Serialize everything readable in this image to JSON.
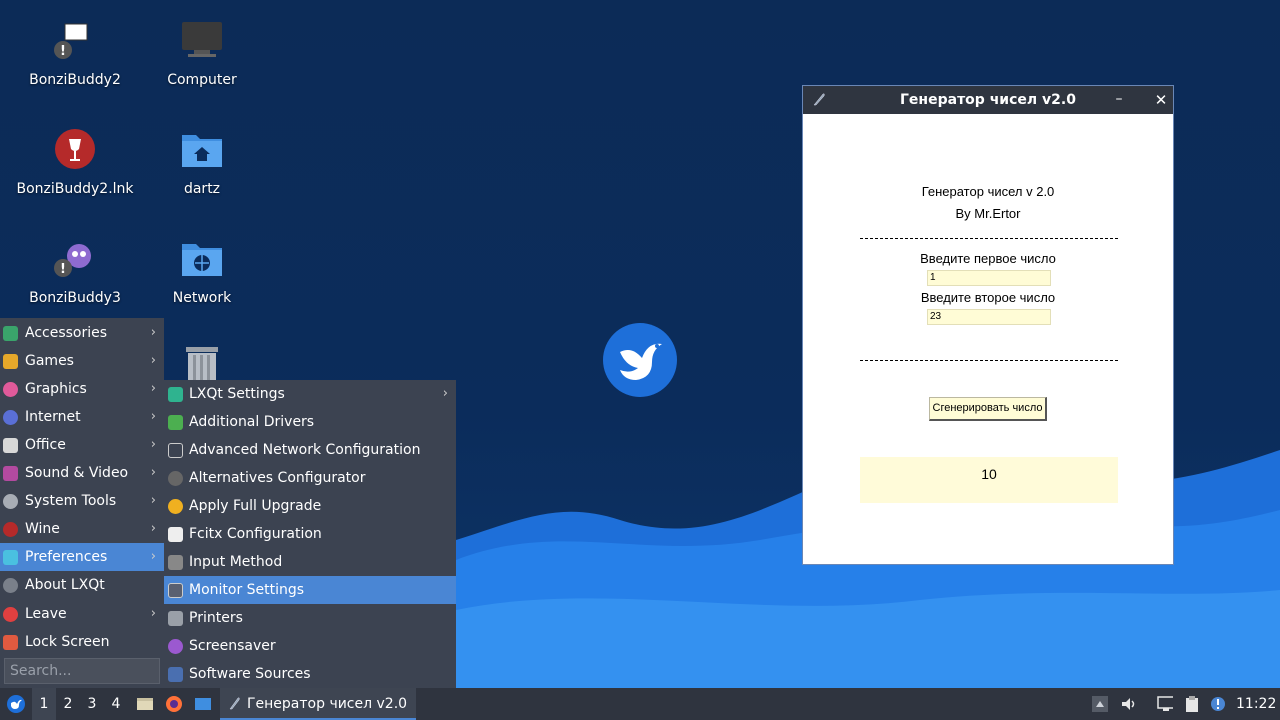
{
  "desktop": {
    "icons": [
      {
        "label": "BonziBuddy2"
      },
      {
        "label": "Computer"
      },
      {
        "label": "BonziBuddy2.lnk"
      },
      {
        "label": "dartz"
      },
      {
        "label": "BonziBuddy3"
      },
      {
        "label": "Network"
      }
    ]
  },
  "window": {
    "title": "Генератор чисел v2.0",
    "minimize_glyph": "–",
    "close_glyph": "✕",
    "heading": "Генератор чисел v 2.0",
    "author": "By Mr.Ertor",
    "first_label": "Введите первое число",
    "first_value": "1",
    "second_label": "Введите второе число",
    "second_value": "23",
    "button_label": "Сгенерировать число",
    "result": "10"
  },
  "start_menu": {
    "categories": [
      {
        "label": "Accessories",
        "icon": "accessories-icon",
        "submenu": true
      },
      {
        "label": "Games",
        "icon": "games-icon",
        "submenu": true
      },
      {
        "label": "Graphics",
        "icon": "graphics-icon",
        "submenu": true
      },
      {
        "label": "Internet",
        "icon": "internet-icon",
        "submenu": true
      },
      {
        "label": "Office",
        "icon": "office-icon",
        "submenu": true
      },
      {
        "label": "Sound & Video",
        "icon": "sound-video-icon",
        "submenu": true
      },
      {
        "label": "System Tools",
        "icon": "system-tools-icon",
        "submenu": true
      },
      {
        "label": "Wine",
        "icon": "wine-icon",
        "submenu": true
      },
      {
        "label": "Preferences",
        "icon": "preferences-icon",
        "submenu": true
      },
      {
        "label": "About LXQt",
        "icon": "about-icon",
        "submenu": false
      },
      {
        "label": "Leave",
        "icon": "leave-icon",
        "submenu": true
      },
      {
        "label": "Lock Screen",
        "icon": "lock-icon",
        "submenu": false
      }
    ],
    "selected": "Preferences",
    "search_placeholder": "Search...",
    "preferences_items": [
      {
        "label": "LXQt Settings",
        "icon": "lxqt-settings-icon",
        "submenu": true
      },
      {
        "label": "Additional Drivers",
        "icon": "drivers-icon",
        "submenu": false
      },
      {
        "label": "Advanced Network Configuration",
        "icon": "network-config-icon",
        "submenu": false
      },
      {
        "label": "Alternatives Configurator",
        "icon": "alternatives-icon",
        "submenu": false
      },
      {
        "label": "Apply Full Upgrade",
        "icon": "upgrade-icon",
        "submenu": false
      },
      {
        "label": "Fcitx Configuration",
        "icon": "fcitx-icon",
        "submenu": false
      },
      {
        "label": "Input Method",
        "icon": "keyboard-icon",
        "submenu": false
      },
      {
        "label": "Monitor Settings",
        "icon": "monitor-icon",
        "submenu": false
      },
      {
        "label": "Printers",
        "icon": "printer-icon",
        "submenu": false
      },
      {
        "label": "Screensaver",
        "icon": "screensaver-icon",
        "submenu": false
      },
      {
        "label": "Software Sources",
        "icon": "software-sources-icon",
        "submenu": false
      }
    ],
    "preferences_selected": "Monitor Settings"
  },
  "taskbar": {
    "workspaces": [
      "1",
      "2",
      "3",
      "4"
    ],
    "active_workspace": "1",
    "task_title": "Генератор чисел v2.0",
    "clock": "11:22"
  },
  "colors": {
    "accent": "#4a86d4",
    "menu_bg": "#3c4351",
    "taskbar_bg": "#2f343f",
    "desktop_bg": "#0b2c5b",
    "wave": "#1e6fd9"
  }
}
